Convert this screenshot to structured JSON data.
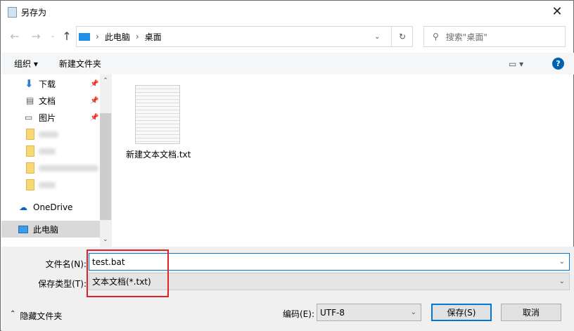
{
  "title": "另存为",
  "address": {
    "crumbs": [
      "此电脑",
      "桌面"
    ]
  },
  "search": {
    "placeholder": "搜索\"桌面\""
  },
  "toolbar": {
    "organize": "组织 ▾",
    "new_folder": "新建文件夹"
  },
  "sidebar": {
    "items": [
      {
        "label": "下载",
        "pinned": true
      },
      {
        "label": "文档",
        "pinned": true
      },
      {
        "label": "图片",
        "pinned": true
      },
      {
        "label": "OneDrive"
      },
      {
        "label": "此电脑",
        "selected": true
      }
    ]
  },
  "files": [
    {
      "name": "新建文本文档.txt"
    }
  ],
  "form": {
    "filename_label": "文件名(N):",
    "filename_value": "test.bat",
    "type_label": "保存类型(T):",
    "type_value": "文本文档(*.txt)",
    "encoding_label": "编码(E):",
    "encoding_value": "UTF-8"
  },
  "buttons": {
    "hide_folders": "隐藏文件夹",
    "save": "保存(S)",
    "cancel": "取消"
  },
  "colors": {
    "accent": "#0078d7",
    "highlight_box": "#e0202a"
  }
}
